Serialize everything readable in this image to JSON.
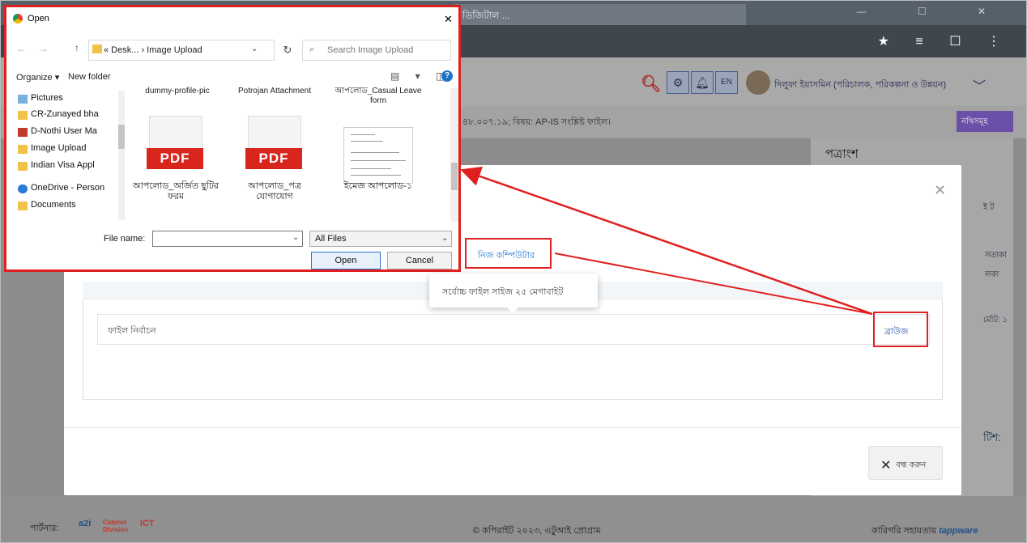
{
  "browser": {
    "tab_title": "ডিজিটাল ...",
    "window_controls": "— ☐ ✕",
    "toolbar_icons": "★ ≡ ☐ ⋮"
  },
  "app": {
    "user_name": "দিলুফা ইয়াসমিন (পরিচালক, পরিকল্পনা ও উন্নয়ন)",
    "lang_label": "EN",
    "subject_text": "৪৮.০০৭.১৯; বিষয়: AP-IS সংশ্লিষ্ট ফাইল।",
    "nothi_button": "নথিসমূহ",
    "side_title": "পত্রাংশ",
    "side_fragments": [
      "ই  ট",
      "সতাকা",
      "লকা",
      "র্মোট: ১",
      "টিশ:"
    ],
    "footer_partner_label": "পার্টনার:",
    "footer_copyright": "© কপিরাইট ২০২৩, এটুআই প্রোগ্রাম",
    "footer_tech_label": "কারিগরি সহায়তায়",
    "footer_tech_brand": "tappware",
    "logos": [
      "a2i",
      "Cabinet Division",
      "ICT"
    ]
  },
  "modal": {
    "tab_label": "নিজ কম্পিউটার",
    "tooltip": "সর্বোচ্চ ফাইল সাইজ ২৫ মেগাবাইট",
    "file_label": "ফাইল নির্বাচন",
    "browse_label": "ব্রাউজ",
    "close_label": "বন্ধ করুন"
  },
  "dialog": {
    "title": "Open",
    "path_text": "« Desk... › Image Upload",
    "search_placeholder": "Search Image Upload",
    "organize_label": "Organize ▾",
    "newfolder_label": "New folder",
    "nav_items": [
      "Pictures",
      "CR-Zunayed bha",
      "D-Nothi User Ma",
      "Image Upload",
      "Indian Visa Appl",
      "OneDrive - Person",
      "Documents"
    ],
    "top_files": [
      "dummy-profile-pic",
      "Potrojan Attachment",
      "আপলোড_Casual Leave form"
    ],
    "files": [
      {
        "type": "PDF",
        "name": "আপলোড_অর্জিত ছুটির ফরম"
      },
      {
        "type": "PDF",
        "name": "আপলোড_পত্র যোগাযোগ"
      },
      {
        "type": "DOC",
        "name": "ইমেজ আপলোড-১"
      }
    ],
    "filename_label": "File name:",
    "filename_value": "",
    "filter_value": "All Files",
    "open_label": "Open",
    "cancel_label": "Cancel"
  },
  "colors": {
    "highlight": "#e02020",
    "accent": "#2a7ad8",
    "pdf": "#d9261c"
  }
}
